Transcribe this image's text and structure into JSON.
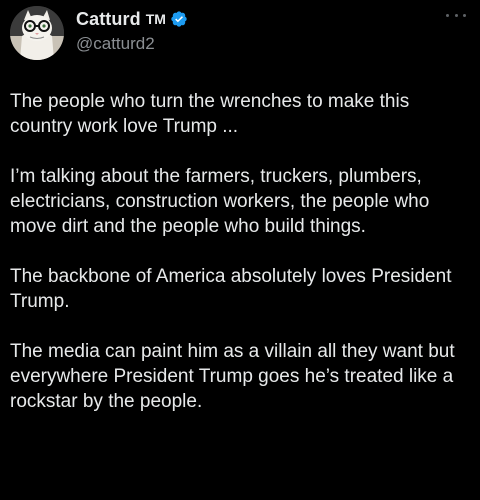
{
  "author": {
    "display_name": "Catturd",
    "tm": "TM",
    "handle": "@catturd2",
    "avatar_icon": "cat-with-glasses-avatar-icon",
    "verified_icon": "verified-badge-icon"
  },
  "more_icon": "more-options-icon",
  "tweet": {
    "paragraphs": [
      "The people who turn the wrenches to make this country work love Trump  ...",
      "I’m talking about the farmers, truckers, plumbers, electricians, construction workers, the people who move dirt and the people who build things.",
      "The backbone of America absolutely loves President Trump.",
      "The media can paint him as a villain all they want but everywhere President Trump goes he’s treated like a rockstar by the people."
    ]
  },
  "colors": {
    "background": "#000000",
    "text": "#e7e9ea",
    "secondary_text": "#8b8f93",
    "verified_blue": "#1d9bf0"
  }
}
